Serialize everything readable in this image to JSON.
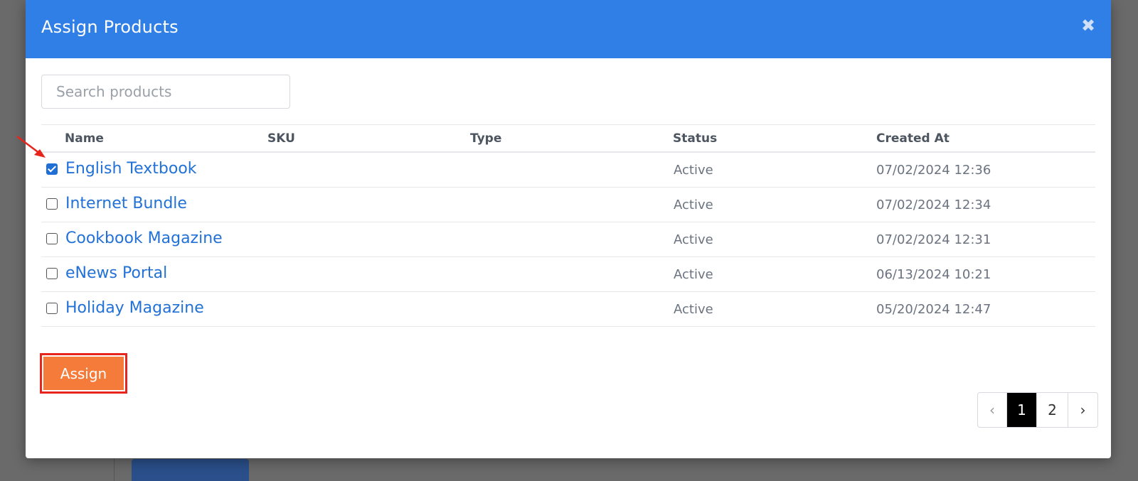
{
  "modal": {
    "title": "Assign Products",
    "close_glyph": "✖"
  },
  "search": {
    "placeholder": "Search products",
    "value": ""
  },
  "table": {
    "columns": [
      "Name",
      "SKU",
      "Type",
      "Status",
      "Created At"
    ],
    "rows": [
      {
        "name": "English Textbook",
        "sku": "",
        "type": "",
        "status": "Active",
        "created_at": "07/02/2024 12:36",
        "checked": true
      },
      {
        "name": "Internet Bundle",
        "sku": "",
        "type": "",
        "status": "Active",
        "created_at": "07/02/2024 12:34",
        "checked": false
      },
      {
        "name": "Cookbook Magazine",
        "sku": "",
        "type": "",
        "status": "Active",
        "created_at": "07/02/2024 12:31",
        "checked": false
      },
      {
        "name": "eNews Portal",
        "sku": "",
        "type": "",
        "status": "Active",
        "created_at": "06/13/2024 10:21",
        "checked": false
      },
      {
        "name": "Holiday Magazine",
        "sku": "",
        "type": "",
        "status": "Active",
        "created_at": "05/20/2024 12:47",
        "checked": false
      }
    ]
  },
  "assign_button": {
    "label": "Assign"
  },
  "pagination": {
    "prev": "‹",
    "pages": [
      "1",
      "2"
    ],
    "current": "1",
    "next": "›"
  },
  "colors": {
    "header_bg": "#2f7fe6",
    "link": "#2271d6",
    "assign_bg": "#f47b3a",
    "highlight_border": "#e8251c",
    "active_page_bg": "#000000"
  },
  "icons": {
    "close": "close-icon",
    "checkbox": "checkbox-icon",
    "annotation_arrow": "arrow-icon"
  }
}
